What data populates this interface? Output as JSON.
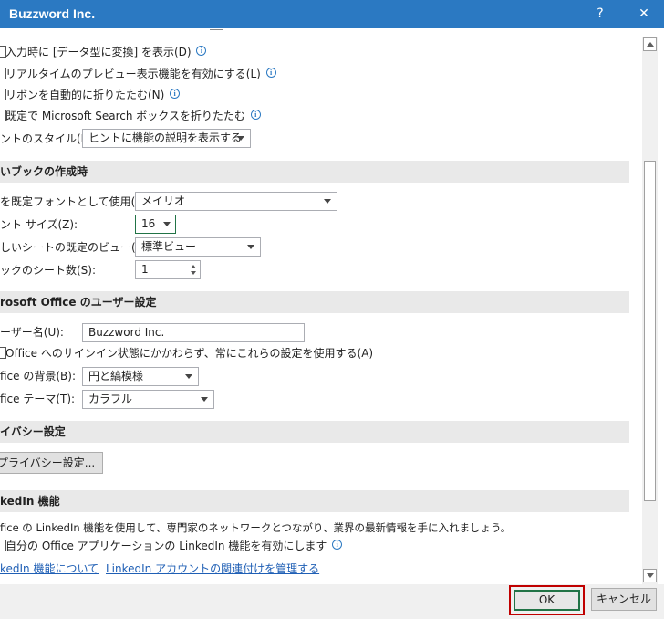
{
  "window": {
    "title": "Buzzword Inc.",
    "help_glyph": "?",
    "close_glyph": "✕"
  },
  "options": {
    "show_convert_data_types": "入力時に [データ型に変換] を表示(D)",
    "enable_live_preview": "リアルタイムのプレビュー表示機能を有効にする(L)",
    "collapse_ribbon": "リボンを自動的に折りたたむ(N)",
    "collapse_search": "既定で Microsoft Search ボックスを折りたたむ",
    "screentip_style_label": "ントのスタイル(R):",
    "screentip_style_value": "ヒントに機能の説明を表示する"
  },
  "new_workbook": {
    "header": "いブックの作成時",
    "default_font_label": "を既定フォントとして使用(N):",
    "default_font_value": "メイリオ",
    "font_size_label": "ント サイズ(Z):",
    "font_size_value": "16",
    "default_view_label": "しいシートの既定のビュー(V):",
    "default_view_value": "標準ビュー",
    "sheet_count_label": "ックのシート数(S):",
    "sheet_count_value": "1"
  },
  "personalize": {
    "header": "rosoft Office のユーザー設定",
    "user_name_label": "ーザー名(U):",
    "user_name_value": "Buzzword Inc.",
    "always_use_label": "Office へのサインイン状態にかかわらず、常にこれらの設定を使用する(A)",
    "background_label": "fice の背景(B):",
    "background_value": "円と縞模様",
    "theme_label": "fice テーマ(T):",
    "theme_value": "カラフル"
  },
  "privacy": {
    "header": "イバシー設定",
    "button_label": "プライバシー設定..."
  },
  "linkedin": {
    "header": "kedIn 機能",
    "description": "fice の LinkedIn 機能を使用して、専門家のネットワークとつながり、業界の最新情報を手に入れましょう。",
    "enable_label": "自分の Office アプリケーションの LinkedIn 機能を有効にします",
    "about_link": "kedIn 機能について",
    "manage_link": "LinkedIn アカウントの関連付けを管理する"
  },
  "footer": {
    "ok_label": "OK",
    "cancel_label": "キャンセル"
  },
  "icons": {
    "info": "info-icon",
    "dropdown": "chevron-down-icon"
  }
}
